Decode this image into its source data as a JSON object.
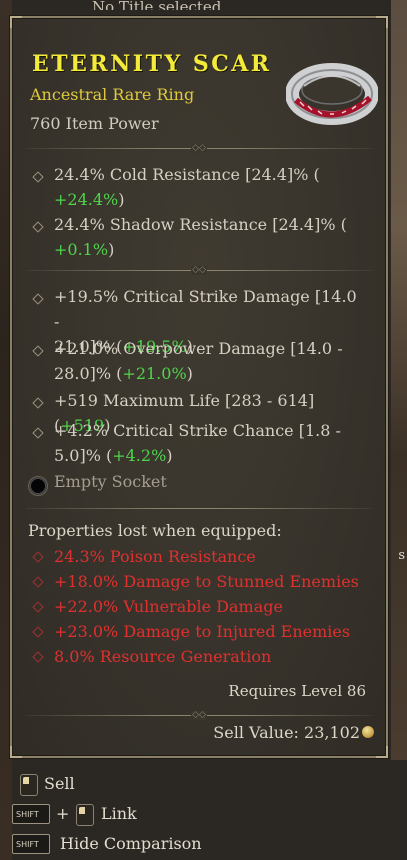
{
  "background": {
    "top_title": "No Title selected",
    "right_glyph": "s"
  },
  "item": {
    "name": "ETERNITY SCAR",
    "type": "Ancestral Rare Ring",
    "power": "760 Item Power",
    "icon": "ring-icon"
  },
  "implicits": [
    {
      "line1": "24.4% Cold Resistance [24.4]% (",
      "line2_green": "+24.4%",
      "line2_tail": ")"
    },
    {
      "line1": "24.4% Shadow Resistance [24.4]% (",
      "line2_green": "+0.1%",
      "line2_tail": ")"
    }
  ],
  "affixes": [
    {
      "line1": "+19.5% Critical Strike Damage [14.0 -",
      "line2": "21.0]% (",
      "green": "+19.5%",
      "tail": ")"
    },
    {
      "line1": "+21.0% Overpower Damage [14.0 -",
      "line2": "28.0]% (",
      "green": "+21.0%",
      "tail": ")"
    },
    {
      "line1": "+519 Maximum Life [283 - 614] (",
      "green": "+519",
      "tail": ")"
    },
    {
      "line1": "+4.2% Critical Strike Chance [1.8 -",
      "line2": "5.0]% (",
      "green": "+4.2%",
      "tail": ")"
    }
  ],
  "socket": {
    "label": "Empty Socket"
  },
  "lost": {
    "title": "Properties lost when equipped:",
    "items": [
      "24.3% Poison Resistance",
      "+18.0% Damage to Stunned Enemies",
      "+22.0% Vulnerable Damage",
      "+23.0% Damage to Injured Enemies",
      "8.0% Resource Generation"
    ]
  },
  "requires": "Requires Level 86",
  "sell_value": "Sell Value: 23,102",
  "hints": {
    "sell": "Sell",
    "plus": "+",
    "link": "Link",
    "hide": "Hide Comparison",
    "shift_key": "SHIFT"
  },
  "colors": {
    "name": "#f3ea39",
    "type": "#dfca3c",
    "bonus_green": "#4fd44c",
    "lost_red": "#e0302e"
  }
}
